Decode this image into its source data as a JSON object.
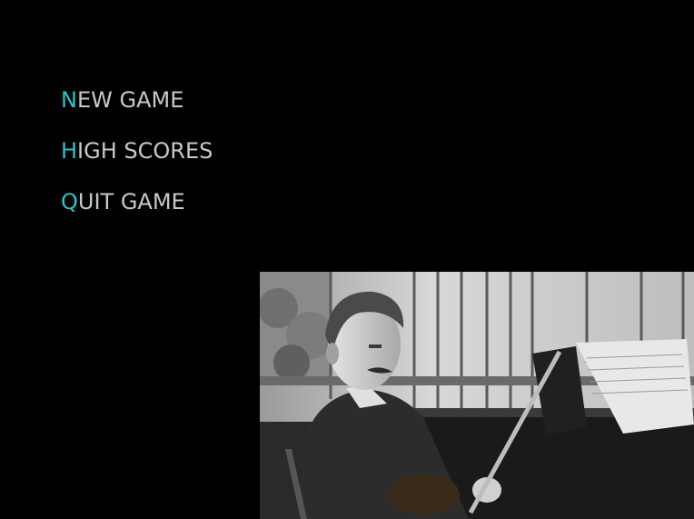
{
  "menu": {
    "items": [
      {
        "hotkey": "N",
        "rest": "EW GAME"
      },
      {
        "hotkey": "H",
        "rest": "IGH SCORES"
      },
      {
        "hotkey": "Q",
        "rest": "UIT GAME"
      }
    ]
  },
  "colors": {
    "background": "#000000",
    "menu_text": "#c8c8c8",
    "hotkey_accent": "#2ec4c4"
  },
  "photo": {
    "subject": "black-and-white photograph of a man seated at a piano holding a violin bow"
  }
}
